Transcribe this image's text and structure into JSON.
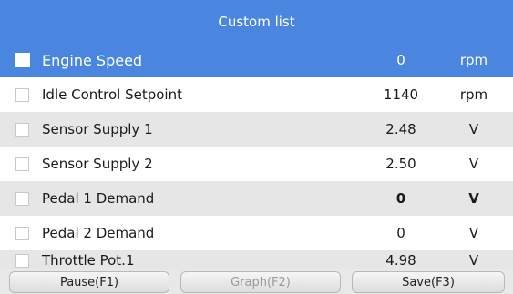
{
  "header": {
    "title": "Custom list"
  },
  "rows": [
    {
      "name": "Engine Speed",
      "value": "0",
      "unit": "rpm",
      "selected": true
    },
    {
      "name": "Idle Control Setpoint",
      "value": "1140",
      "unit": "rpm",
      "selected": false
    },
    {
      "name": "Sensor Supply 1",
      "value": "2.48",
      "unit": "V",
      "selected": false
    },
    {
      "name": "Sensor Supply 2",
      "value": "2.50",
      "unit": "V",
      "selected": false
    },
    {
      "name": "Pedal 1 Demand",
      "value": "0",
      "unit": "V",
      "selected": false
    },
    {
      "name": "Pedal 2 Demand",
      "value": "0",
      "unit": "V",
      "selected": false
    },
    {
      "name": "Throttle Pot.1",
      "value": "4.98",
      "unit": "V",
      "selected": false
    }
  ],
  "toolbar": {
    "pause_label": "Pause(F1)",
    "graph_label": "Graph(F2)",
    "save_label": "Save(F3)"
  },
  "colors": {
    "accent": "#4a86e0",
    "alt_row": "#e6e6e6"
  }
}
